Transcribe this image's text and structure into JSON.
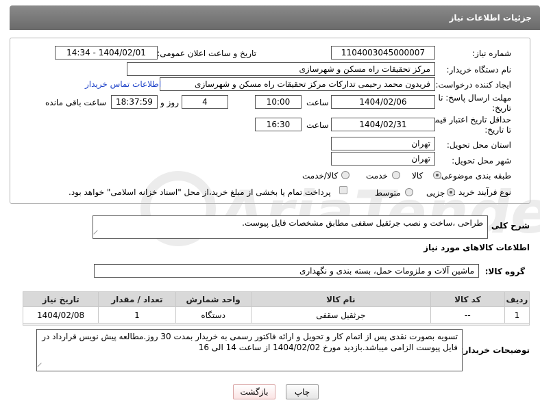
{
  "page": {
    "title": "جزئیات اطلاعات نیاز"
  },
  "form": {
    "need_number": {
      "label": "شماره نیاز:",
      "value": "1104003045000007"
    },
    "announce_datetime": {
      "label": "تاریخ و ساعت اعلان عمومی:",
      "value": "1404/02/01 - 14:34"
    },
    "buyer_org": {
      "label": "نام دستگاه خریدار:",
      "value": "مرکز تحقیقات راه  مسکن و شهرسازی"
    },
    "requester": {
      "label": "ایجاد کننده درخواست:",
      "value": "فریدون محمد رحیمی تدارکات مرکز تحقیقات راه  مسکن و شهرسازی"
    },
    "contact_link": "اطلاعات تماس خریدار",
    "reply_deadline": {
      "label_line1": "مهلت ارسال پاسخ: تا",
      "label_line2": "تاریخ:",
      "date": "1404/02/06",
      "time_label": "ساعت",
      "time": "10:00",
      "days": "4",
      "days_label": "روز و",
      "remaining": "18:37:59",
      "remaining_label": "ساعت باقی مانده"
    },
    "price_validity": {
      "label_line1": "حداقل تاریخ اعتبار قیمت:",
      "label_line2": "تا تاریخ:",
      "date": "1404/02/31",
      "time_label": "ساعت",
      "time": "16:30"
    },
    "delivery_province": {
      "label": "استان محل تحویل:",
      "value": "تهران"
    },
    "delivery_city": {
      "label": "شهر محل تحویل:",
      "value": "تهران"
    },
    "category": {
      "label": "طبقه بندی موضوعی:",
      "options": [
        "کالا",
        "خدمت",
        "کالا/خدمت"
      ],
      "selected": "کالا"
    },
    "purchase_type": {
      "label": "نوع فرآیند خرید :",
      "options": [
        "جزیی",
        "متوسط"
      ],
      "selected": "جزیی",
      "treasury_note": "پرداخت تمام یا بخشی از مبلغ خرید،از محل \"اسناد خزانه اسلامی\" خواهد بود."
    }
  },
  "description": {
    "label": "شرح کلی نیاز:",
    "value": "طراحی ،ساخت و نصب جرثقیل سقفی مطابق مشخصات فایل پیوست."
  },
  "goods": {
    "section_title": "اطلاعات کالاهای مورد نیاز",
    "group_label": "گروه کالا:",
    "group_value": "ماشین آلات و ملزومات حمل، بسته بندی و نگهداری",
    "columns": [
      "ردیف",
      "کد کالا",
      "نام کالا",
      "واحد شمارش",
      "تعداد / مقدار",
      "تاریخ نیاز"
    ],
    "rows": [
      {
        "row": "1",
        "code": "--",
        "name": "جرثقیل سقفی",
        "unit": "دستگاه",
        "qty": "1",
        "date": "1404/02/08"
      }
    ]
  },
  "buyer_notes": {
    "label": "توضیحات خریدار:",
    "value": "تسویه بصورت نقدی پس از اتمام کار و تحویل و ارائه فاکتور رسمی به خریدار بمدت 30 روز.مطالعه پیش نویس قرارداد در فایل پیوست الزامی میباشد.بازدید مورخ 1404/02/02 از ساعت 14 الی 16"
  },
  "buttons": {
    "print": "چاپ",
    "back": "بازگشت"
  },
  "colors": {
    "title_bar": "#777777",
    "link": "#1a3fc7",
    "table_header": "#d9d9d9"
  }
}
